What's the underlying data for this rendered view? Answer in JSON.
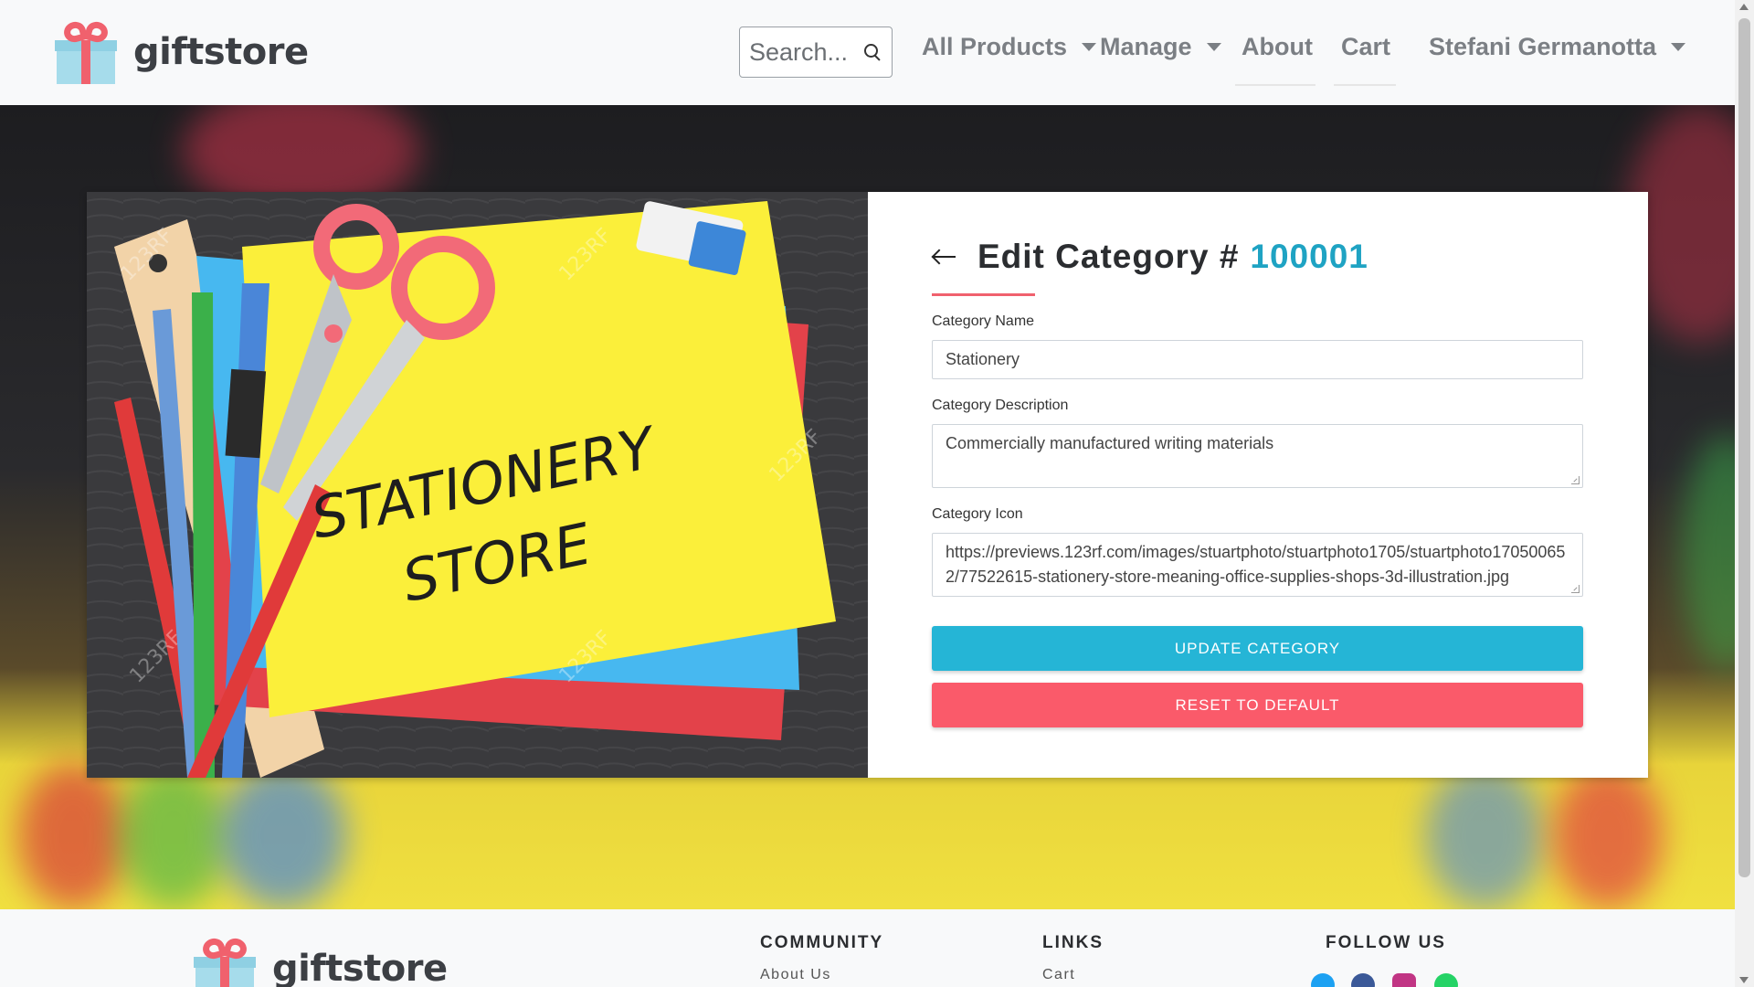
{
  "brand": {
    "name": "giftstore"
  },
  "nav": {
    "search_placeholder": "Search...",
    "all_products": "All Products",
    "manage": "Manage",
    "about": "About",
    "cart": "Cart",
    "user": "Stefani Germanotta"
  },
  "hero_image": {
    "line1": "STATIONERY",
    "line2": "STORE",
    "watermark": "123RF"
  },
  "form": {
    "title": "Edit Category #",
    "category_id": "100001",
    "name_label": "Category Name",
    "name_value": "Stationery",
    "description_label": "Category Description",
    "description_value": "Commercially manufactured writing materials",
    "icon_label": "Category Icon",
    "icon_value": "https://previews.123rf.com/images/stuartphoto/stuartphoto1705/stuartphoto170500652/77522615-stationery-store-meaning-office-supplies-shops-3d-illustration.jpg",
    "update_button": "UPDATE CATEGORY",
    "reset_button": "RESET TO DEFAULT"
  },
  "footer": {
    "community_heading": "COMMUNITY",
    "community_link": "About Us",
    "links_heading": "LINKS",
    "links_link": "Cart",
    "follow_heading": "FOLLOW US",
    "social_icons": [
      "twitter-icon",
      "facebook-icon",
      "instagram-icon",
      "whatsapp-icon"
    ]
  },
  "colors": {
    "accent": "#1fa3c3",
    "update_button": "#25b5d6",
    "reset_button": "#fa5a6a",
    "title_rule": "#f0616d"
  }
}
